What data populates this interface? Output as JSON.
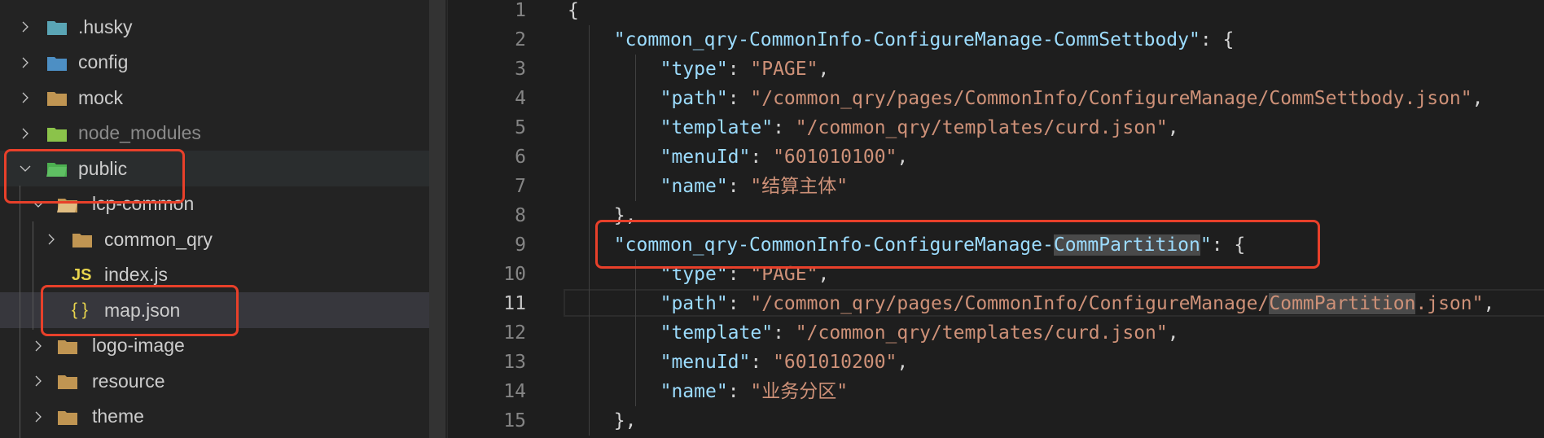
{
  "explorer": {
    "items": [
      {
        "label": ".husky",
        "icon": "husky-folder-icon",
        "expanded": false,
        "level": 0
      },
      {
        "label": "config",
        "icon": "config-folder-icon",
        "expanded": false,
        "level": 0
      },
      {
        "label": "mock",
        "icon": "folder-icon",
        "expanded": false,
        "level": 0
      },
      {
        "label": "node_modules",
        "icon": "node-folder-icon",
        "expanded": false,
        "level": 0,
        "dimmed": true
      },
      {
        "label": "public",
        "icon": "public-folder-icon",
        "expanded": true,
        "level": 0,
        "highlighted": true
      },
      {
        "label": "lcp-common",
        "icon": "open-folder-icon",
        "expanded": true,
        "level": 1
      },
      {
        "label": "common_qry",
        "icon": "folder-icon",
        "expanded": false,
        "level": 2
      },
      {
        "label": "index.js",
        "icon": "js-file-icon",
        "icon_text": "JS",
        "level": 2
      },
      {
        "label": "map.json",
        "icon": "json-file-icon",
        "icon_text": "{ }",
        "level": 2,
        "selected": true,
        "highlighted": true
      },
      {
        "label": "logo-image",
        "icon": "folder-icon",
        "expanded": false,
        "level": 1
      },
      {
        "label": "resource",
        "icon": "folder-icon",
        "expanded": false,
        "level": 1
      },
      {
        "label": "theme",
        "icon": "theme-folder-icon",
        "expanded": false,
        "level": 1
      }
    ]
  },
  "editor": {
    "current_line": 11,
    "highlighted_line": 9,
    "lines": [
      [
        [
          "p",
          "{"
        ]
      ],
      [
        [
          "k",
          "\"common_qry-CommonInfo-ConfigureManage-CommSettbody\""
        ],
        [
          "p",
          ": {"
        ]
      ],
      [
        [
          "k",
          "\"type\""
        ],
        [
          "p",
          ": "
        ],
        [
          "s",
          "\"PAGE\""
        ],
        [
          "p",
          ","
        ]
      ],
      [
        [
          "k",
          "\"path\""
        ],
        [
          "p",
          ": "
        ],
        [
          "s",
          "\"/common_qry/pages/CommonInfo/ConfigureManage/CommSettbody.json\""
        ],
        [
          "p",
          ","
        ]
      ],
      [
        [
          "k",
          "\"template\""
        ],
        [
          "p",
          ": "
        ],
        [
          "s",
          "\"/common_qry/templates/curd.json\""
        ],
        [
          "p",
          ","
        ]
      ],
      [
        [
          "k",
          "\"menuId\""
        ],
        [
          "p",
          ": "
        ],
        [
          "s",
          "\"601010100\""
        ],
        [
          "p",
          ","
        ]
      ],
      [
        [
          "k",
          "\"name\""
        ],
        [
          "p",
          ": "
        ],
        [
          "s",
          "\"结算主体\""
        ]
      ],
      [
        [
          "p",
          "},"
        ]
      ],
      [
        [
          "k",
          "\"common_qry-CommonInfo-ConfigureManage-"
        ],
        [
          "kh",
          "CommPartition"
        ],
        [
          "k",
          "\""
        ],
        [
          "p",
          ": {"
        ]
      ],
      [
        [
          "k",
          "\"type\""
        ],
        [
          "p",
          ": "
        ],
        [
          "s",
          "\"PAGE\""
        ],
        [
          "p",
          ","
        ]
      ],
      [
        [
          "k",
          "\"path\""
        ],
        [
          "p",
          ": "
        ],
        [
          "s",
          "\"/common_qry/pages/CommonInfo/ConfigureManage/"
        ],
        [
          "sh",
          "CommPartition"
        ],
        [
          "s",
          ".json\""
        ],
        [
          "p",
          ","
        ]
      ],
      [
        [
          "k",
          "\"template\""
        ],
        [
          "p",
          ": "
        ],
        [
          "s",
          "\"/common_qry/templates/curd.json\""
        ],
        [
          "p",
          ","
        ]
      ],
      [
        [
          "k",
          "\"menuId\""
        ],
        [
          "p",
          ": "
        ],
        [
          "s",
          "\"601010200\""
        ],
        [
          "p",
          ","
        ]
      ],
      [
        [
          "k",
          "\"name\""
        ],
        [
          "p",
          ": "
        ],
        [
          "s",
          "\"业务分区\""
        ]
      ],
      [
        [
          "p",
          "},"
        ]
      ]
    ],
    "indents": [
      0,
      1,
      2,
      2,
      2,
      2,
      2,
      1,
      1,
      2,
      2,
      2,
      2,
      2,
      1
    ]
  },
  "colors": {
    "annotation_box": "#e8402a",
    "key": "#9cdcfe",
    "string": "#ce9178"
  }
}
